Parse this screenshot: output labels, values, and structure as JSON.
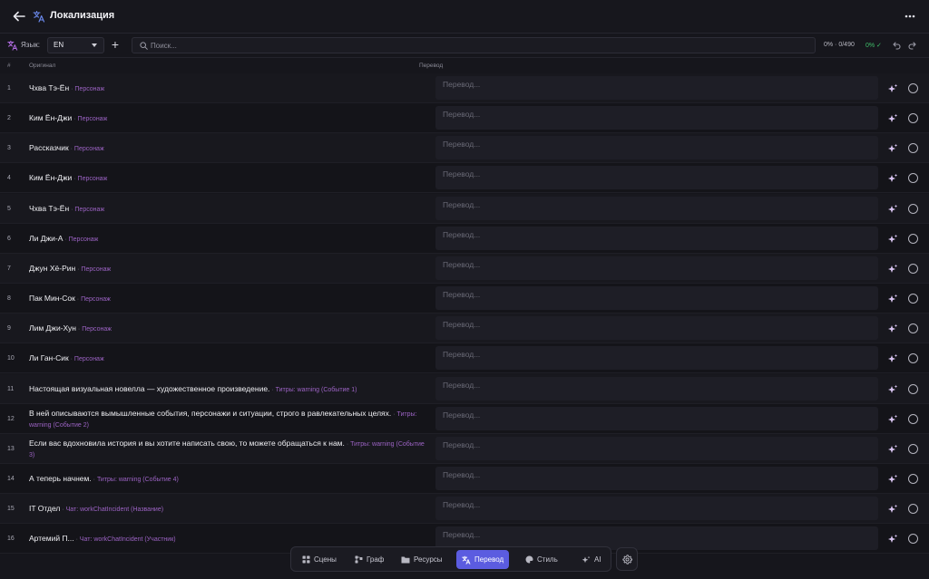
{
  "header": {
    "title": "Локализация"
  },
  "toolbar": {
    "language_label": "Язык:",
    "language_value": "EN",
    "add_label": "+",
    "search_placeholder": "Поиск...",
    "progress_count": "0% · 0/490",
    "progress_percent": "0% ✓"
  },
  "columns": {
    "num": "#",
    "original": "Оригинал",
    "translation": "Перевод"
  },
  "translation_placeholder": "Перевод...",
  "rows": [
    {
      "num": "1",
      "text": "Чхва Тэ-Ён",
      "tag": "Персонаж"
    },
    {
      "num": "2",
      "text": "Ким Ён-Джи",
      "tag": "Персонаж"
    },
    {
      "num": "3",
      "text": "Рассказчик",
      "tag": "Персонаж"
    },
    {
      "num": "4",
      "text": "Ким Ён-Джи",
      "tag": "Персонаж"
    },
    {
      "num": "5",
      "text": "Чхва Тэ-Ён",
      "tag": "Персонаж"
    },
    {
      "num": "6",
      "text": "Ли Джи-А",
      "tag": "Персонаж"
    },
    {
      "num": "7",
      "text": "Джун Хё-Рин",
      "tag": "Персонаж"
    },
    {
      "num": "8",
      "text": "Пак Мин-Сок",
      "tag": "Персонаж"
    },
    {
      "num": "9",
      "text": "Лим Джи-Хун",
      "tag": "Персонаж"
    },
    {
      "num": "10",
      "text": "Ли Ган-Сик",
      "tag": "Персонаж"
    },
    {
      "num": "11",
      "text": "Настоящая визуальная новелла — художественное произведение.",
      "tag": "Титры: warning (Событие 1)"
    },
    {
      "num": "12",
      "text": "В ней описываются вымышленные события, персонажи и ситуации, строго в равлекательных целях.",
      "tag": "Титры: warning (Событие 2)"
    },
    {
      "num": "13",
      "text": "Если вас вдохновила история и вы хотите написать свою, то можете обращаться к нам.",
      "tag": "Титры: warning (Событие 3)"
    },
    {
      "num": "14",
      "text": "А теперь начнем.",
      "tag": "Титры: warning (Событие 4)"
    },
    {
      "num": "15",
      "text": "IT Отдел",
      "tag": "Чат: workChatIncident (Название)"
    },
    {
      "num": "16",
      "text": "Артемий П...",
      "tag": "Чат: workChatIncident (Участник)"
    }
  ],
  "dock": {
    "items": [
      {
        "label": "Сцены",
        "icon": "grid-icon"
      },
      {
        "label": "Граф",
        "icon": "graph-icon"
      },
      {
        "label": "Ресурсы",
        "icon": "folder-icon"
      },
      {
        "label": "Перевод",
        "icon": "translate-icon",
        "active": true
      },
      {
        "label": "Стиль",
        "icon": "palette-icon"
      },
      {
        "label": "AI",
        "icon": "sparkle-icon"
      }
    ],
    "settings_icon": "gear-icon"
  },
  "colors": {
    "accent": "#5b5ce0",
    "tag": "#9c63c4",
    "success": "#3fbf6a",
    "icon_purple": "#b06be0"
  }
}
